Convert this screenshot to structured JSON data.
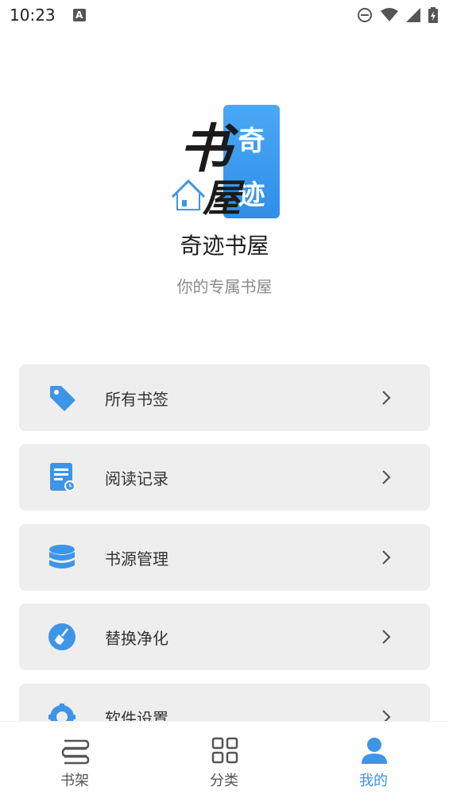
{
  "status_bar": {
    "time": "10:23",
    "notification_letter": "A",
    "icons": [
      "dnd-icon",
      "wifi-icon",
      "signal-icon",
      "battery-icon"
    ]
  },
  "profile": {
    "logo_text_left_top": "书",
    "logo_text_left_bottom": "屋",
    "logo_text_right_top": "奇",
    "logo_text_right_bottom": "迹",
    "app_name": "奇迹书屋",
    "slogan": "你的专属书屋"
  },
  "menu": {
    "items": [
      {
        "label": "所有书签",
        "icon": "tag-icon"
      },
      {
        "label": "阅读记录",
        "icon": "reading-history-icon"
      },
      {
        "label": "书源管理",
        "icon": "database-icon"
      },
      {
        "label": "替换净化",
        "icon": "broom-icon"
      },
      {
        "label": "软件设置",
        "icon": "gear-icon"
      }
    ]
  },
  "tab_bar": {
    "tabs": [
      {
        "label": "书架",
        "icon": "bookshelf-icon",
        "active": false
      },
      {
        "label": "分类",
        "icon": "category-grid-icon",
        "active": false
      },
      {
        "label": "我的",
        "icon": "person-icon",
        "active": true
      }
    ]
  },
  "colors": {
    "accent": "#3d95e8",
    "menu_bg": "#eeeeee",
    "text_primary": "#333333",
    "text_secondary": "#8a8a8a"
  }
}
